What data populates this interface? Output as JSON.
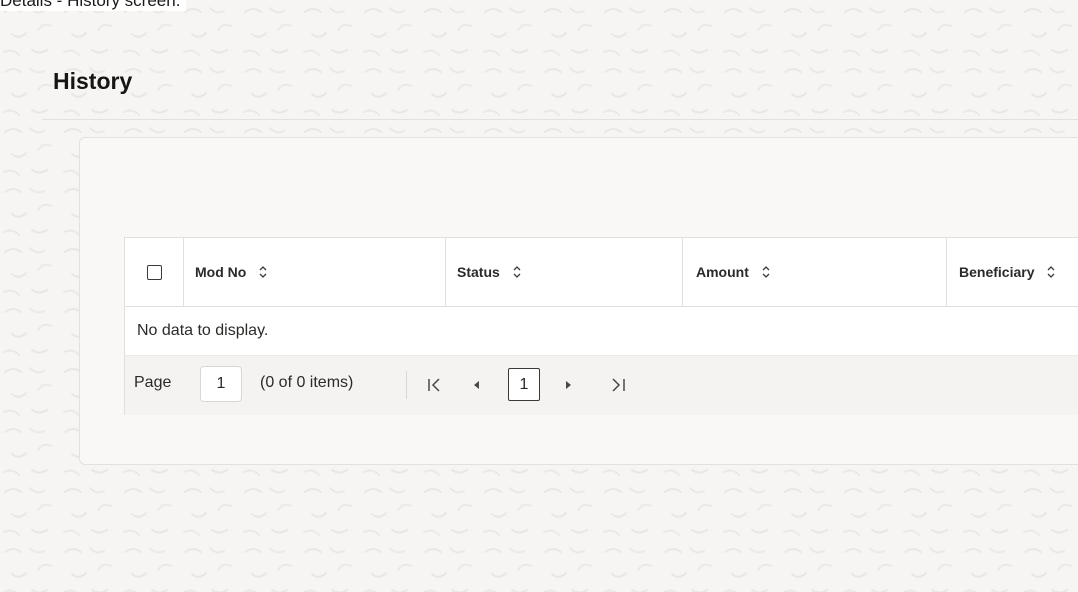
{
  "caption": "Details - History screen.",
  "page_title": "History",
  "table": {
    "columns": [
      {
        "label": "Mod No"
      },
      {
        "label": "Status"
      },
      {
        "label": "Amount"
      },
      {
        "label": "Beneficiary"
      }
    ],
    "empty_message": "No data to display."
  },
  "pagination": {
    "page_label": "Page",
    "page_value": "1",
    "range_text": "(0 of 0 items)",
    "current_page": "1"
  },
  "icons": {
    "select_all": "checkbox-icon",
    "sort": "sort-icon",
    "first": "first-page-icon",
    "prev": "previous-page-icon",
    "next": "next-page-icon",
    "last": "last-page-icon"
  },
  "colors": {
    "background": "#f6f5f4",
    "card": "#f9f8f7",
    "border": "#e1dfdb",
    "text": "#161513"
  }
}
